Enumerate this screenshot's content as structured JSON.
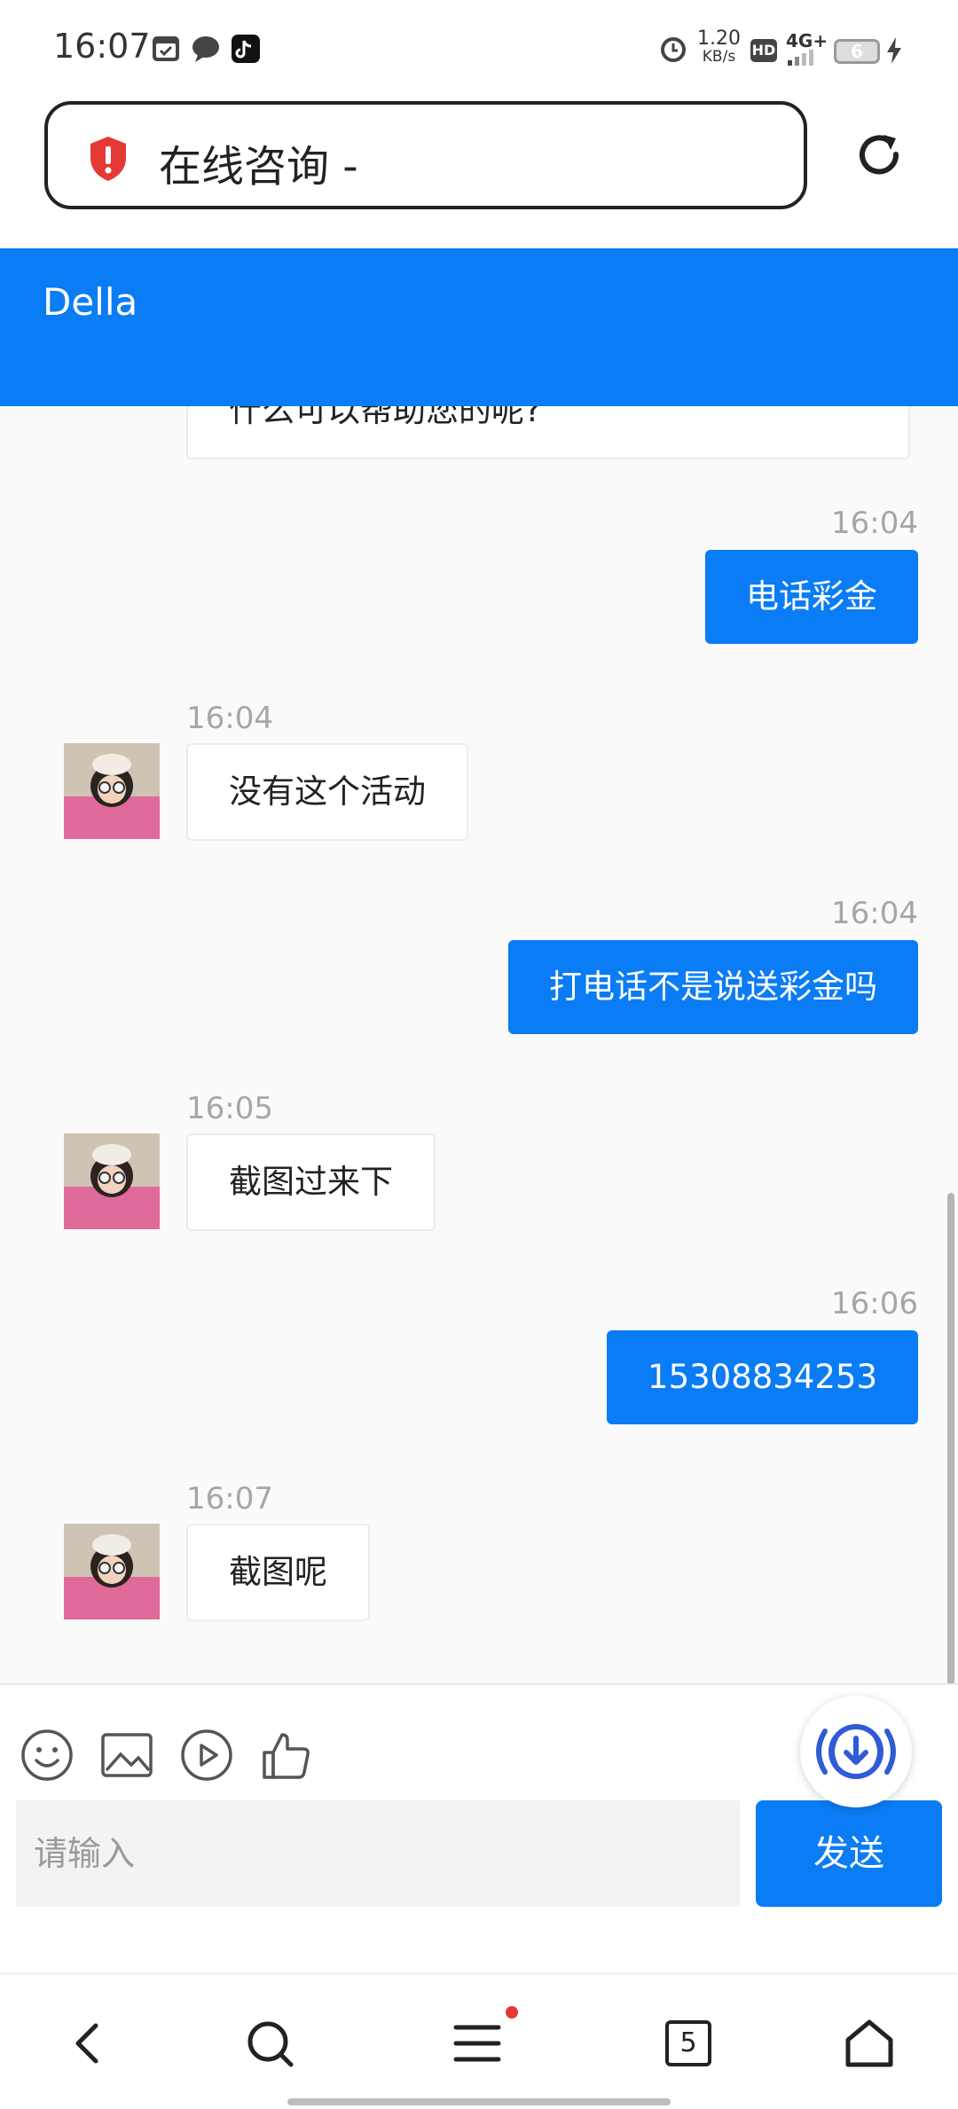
{
  "status_bar": {
    "time": "16:07",
    "net_speed_value": "1.20",
    "net_speed_unit": "KB/s",
    "hd": "HD",
    "signal": "4G+",
    "battery": "6"
  },
  "browser": {
    "page_title": "在线咨询 -"
  },
  "chat": {
    "agent_name": "Della",
    "partial_message": "什么可以帮助您的呢?",
    "messages": [
      {
        "from": "user",
        "time": "16:04",
        "text": "电话彩金"
      },
      {
        "from": "agent",
        "time": "16:04",
        "text": "没有这个活动"
      },
      {
        "from": "user",
        "time": "16:04",
        "text": "打电话不是说送彩金吗"
      },
      {
        "from": "agent",
        "time": "16:05",
        "text": "截图过来下"
      },
      {
        "from": "user",
        "time": "16:06",
        "text": "15308834253"
      },
      {
        "from": "agent",
        "time": "16:07",
        "text": "截图呢"
      }
    ]
  },
  "composer": {
    "placeholder": "请输入",
    "send_label": "发送",
    "tools": [
      "emoji-icon",
      "image-icon",
      "video-icon",
      "thumbs-up-icon"
    ]
  },
  "navbar": {
    "tabs_count": "5"
  },
  "colors": {
    "accent": "#0a7cf5",
    "timestamp": "#a6a6a6"
  }
}
